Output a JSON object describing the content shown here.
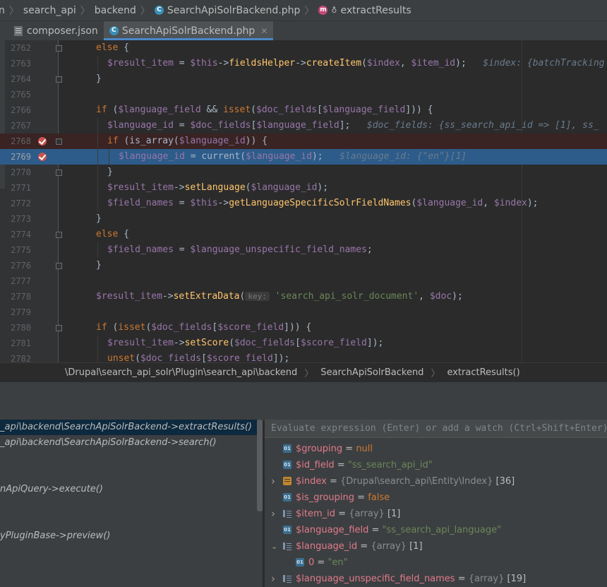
{
  "navbar": {
    "items": [
      "n",
      "search_api",
      "backend",
      "SearchApiSolrBackend.php",
      "extractResults"
    ]
  },
  "tabs": [
    {
      "label": "composer.json",
      "active": false
    },
    {
      "label": "SearchApiSolrBackend.php",
      "active": true
    }
  ],
  "editor": {
    "lines": [
      {
        "num": "2762",
        "tokens": [
          [
            "kw",
            "else"
          ],
          [
            "plain",
            " {"
          ]
        ]
      },
      {
        "num": "2763",
        "tokens": [
          [
            "var",
            "$result_item"
          ],
          [
            "plain",
            " = "
          ],
          [
            "var",
            "$this"
          ],
          [
            "plain",
            "->"
          ],
          [
            "fn",
            "fieldsHelper"
          ],
          [
            "plain",
            "->"
          ],
          [
            "fn",
            "createItem"
          ],
          [
            "plain",
            "("
          ],
          [
            "var",
            "$index"
          ],
          [
            "plain",
            ", "
          ],
          [
            "var",
            "$item_id"
          ],
          [
            "plain",
            ");   "
          ],
          [
            "inl",
            "$index: {batchTracking"
          ]
        ]
      },
      {
        "num": "2764",
        "tokens": [
          [
            "plain",
            "}"
          ]
        ]
      },
      {
        "num": "2765",
        "tokens": []
      },
      {
        "num": "2766",
        "tokens": [
          [
            "kw",
            "if"
          ],
          [
            "plain",
            " ("
          ],
          [
            "var",
            "$language_field"
          ],
          [
            "plain",
            " && "
          ],
          [
            "kw",
            "isset"
          ],
          [
            "plain",
            "("
          ],
          [
            "var",
            "$doc_fields"
          ],
          [
            "plain",
            "["
          ],
          [
            "var",
            "$language_field"
          ],
          [
            "plain",
            "])) {"
          ]
        ]
      },
      {
        "num": "2767",
        "tokens": [
          [
            "var",
            "$language_id"
          ],
          [
            "plain",
            " = "
          ],
          [
            "var",
            "$doc_fields"
          ],
          [
            "plain",
            "["
          ],
          [
            "var",
            "$language_field"
          ],
          [
            "plain",
            "];   "
          ],
          [
            "inl",
            "$doc_fields: {ss_search_api_id => [1], ss_"
          ]
        ]
      },
      {
        "num": "2768",
        "tokens": [
          [
            "kw",
            "if"
          ],
          [
            "plain",
            " (is_array("
          ],
          [
            "var",
            "$language_id"
          ],
          [
            "plain",
            ")) {"
          ]
        ]
      },
      {
        "num": "2769",
        "tokens": [
          [
            "var",
            "$language_id"
          ],
          [
            "plain",
            " = current("
          ],
          [
            "var",
            "$language_id"
          ],
          [
            "plain",
            ");   "
          ],
          [
            "inl",
            "$language_id: {\"en\"}[1]"
          ]
        ]
      },
      {
        "num": "2770",
        "tokens": [
          [
            "plain",
            "}"
          ]
        ]
      },
      {
        "num": "2771",
        "tokens": [
          [
            "var",
            "$result_item"
          ],
          [
            "plain",
            "->"
          ],
          [
            "fn",
            "setLanguage"
          ],
          [
            "plain",
            "("
          ],
          [
            "var",
            "$language_id"
          ],
          [
            "plain",
            ");"
          ]
        ]
      },
      {
        "num": "2772",
        "tokens": [
          [
            "var",
            "$field_names"
          ],
          [
            "plain",
            " = "
          ],
          [
            "var",
            "$this"
          ],
          [
            "plain",
            "->"
          ],
          [
            "fn",
            "getLanguageSpecificSolrFieldNames"
          ],
          [
            "plain",
            "("
          ],
          [
            "var",
            "$language_id"
          ],
          [
            "plain",
            ", "
          ],
          [
            "var",
            "$index"
          ],
          [
            "plain",
            ");"
          ]
        ]
      },
      {
        "num": "2773",
        "tokens": [
          [
            "plain",
            "}"
          ]
        ]
      },
      {
        "num": "2774",
        "tokens": [
          [
            "kw",
            "else"
          ],
          [
            "plain",
            " {"
          ]
        ]
      },
      {
        "num": "2775",
        "tokens": [
          [
            "var",
            "$field_names"
          ],
          [
            "plain",
            " = "
          ],
          [
            "var",
            "$language_unspecific_field_names"
          ],
          [
            "plain",
            ";"
          ]
        ]
      },
      {
        "num": "2776",
        "tokens": [
          [
            "plain",
            "}"
          ]
        ]
      },
      {
        "num": "2777",
        "tokens": []
      },
      {
        "num": "2778",
        "tokens": [
          [
            "var",
            "$result_item"
          ],
          [
            "plain",
            "->"
          ],
          [
            "fn",
            "setExtraData"
          ],
          [
            "plain",
            "("
          ],
          [
            "hint",
            "key:"
          ],
          [
            "plain",
            " "
          ],
          [
            "str",
            "'search_api_solr_document'"
          ],
          [
            "plain",
            ", "
          ],
          [
            "var",
            "$doc"
          ],
          [
            "plain",
            ");"
          ]
        ]
      },
      {
        "num": "2779",
        "tokens": []
      },
      {
        "num": "2780",
        "tokens": [
          [
            "kw",
            "if"
          ],
          [
            "plain",
            " ("
          ],
          [
            "kw",
            "isset"
          ],
          [
            "plain",
            "("
          ],
          [
            "var",
            "$doc_fields"
          ],
          [
            "plain",
            "["
          ],
          [
            "var",
            "$score_field"
          ],
          [
            "plain",
            "])) {"
          ]
        ]
      },
      {
        "num": "2781",
        "tokens": [
          [
            "var",
            "$result_item"
          ],
          [
            "plain",
            "->"
          ],
          [
            "fn",
            "setScore"
          ],
          [
            "plain",
            "("
          ],
          [
            "var",
            "$doc_fields"
          ],
          [
            "plain",
            "["
          ],
          [
            "var",
            "$score_field"
          ],
          [
            "plain",
            "]);"
          ]
        ]
      },
      {
        "num": "2782",
        "tokens": [
          [
            "kw",
            "unset"
          ],
          [
            "plain",
            "("
          ],
          [
            "var",
            "$doc_fields"
          ],
          [
            "plain",
            "["
          ],
          [
            "var",
            "$score_field"
          ],
          [
            "plain",
            "]);"
          ]
        ]
      }
    ]
  },
  "breadcrumb": {
    "items": [
      "\\Drupal\\search_api_solr\\Plugin\\search_api\\backend",
      "SearchApiSolrBackend",
      "extractResults()"
    ]
  },
  "frames": [
    "_api\\backend\\SearchApiSolrBackend->extractResults()",
    "_api\\backend\\SearchApiSolrBackend->search()",
    "",
    "nApiQuery->execute()",
    "",
    "",
    "yPluginBase->preview()"
  ],
  "watch": {
    "placeholder": "Evaluate expression (Enter) or add a watch (Ctrl+Shift+Enter)"
  },
  "variables": [
    {
      "name": "$grouping",
      "value": "null",
      "kind": "kw",
      "type": "",
      "icon": "primitive-icon",
      "expand": "",
      "indent": 0
    },
    {
      "name": "$id_field",
      "value": "\"ss_search_api_id\"",
      "kind": "str",
      "type": "",
      "icon": "primitive-icon",
      "expand": "",
      "indent": 0
    },
    {
      "name": "$index",
      "value": "[36]",
      "kind": "plain",
      "type": "{Drupal\\search_api\\Entity\\Index}",
      "icon": "object-icon",
      "expand": "collapsed",
      "indent": 0
    },
    {
      "name": "$is_grouping",
      "value": "false",
      "kind": "kw",
      "type": "",
      "icon": "primitive-icon",
      "expand": "",
      "indent": 0
    },
    {
      "name": "$item_id",
      "value": "[1]",
      "kind": "plain",
      "type": "{array}",
      "icon": "array-icon",
      "expand": "collapsed",
      "indent": 0
    },
    {
      "name": "$language_field",
      "value": "\"ss_search_api_language\"",
      "kind": "str",
      "type": "",
      "icon": "primitive-icon",
      "expand": "",
      "indent": 0
    },
    {
      "name": "$language_id",
      "value": "[1]",
      "kind": "plain",
      "type": "{array}",
      "icon": "array-icon",
      "expand": "expanded",
      "indent": 0
    },
    {
      "name": "0",
      "value": "\"en\"",
      "kind": "str",
      "type": "",
      "icon": "primitive-icon",
      "expand": "",
      "indent": 1
    },
    {
      "name": "$language_unspecific_field_names",
      "value": "[19]",
      "kind": "plain",
      "type": "{array}",
      "icon": "array-icon",
      "expand": "collapsed",
      "indent": 0
    }
  ]
}
